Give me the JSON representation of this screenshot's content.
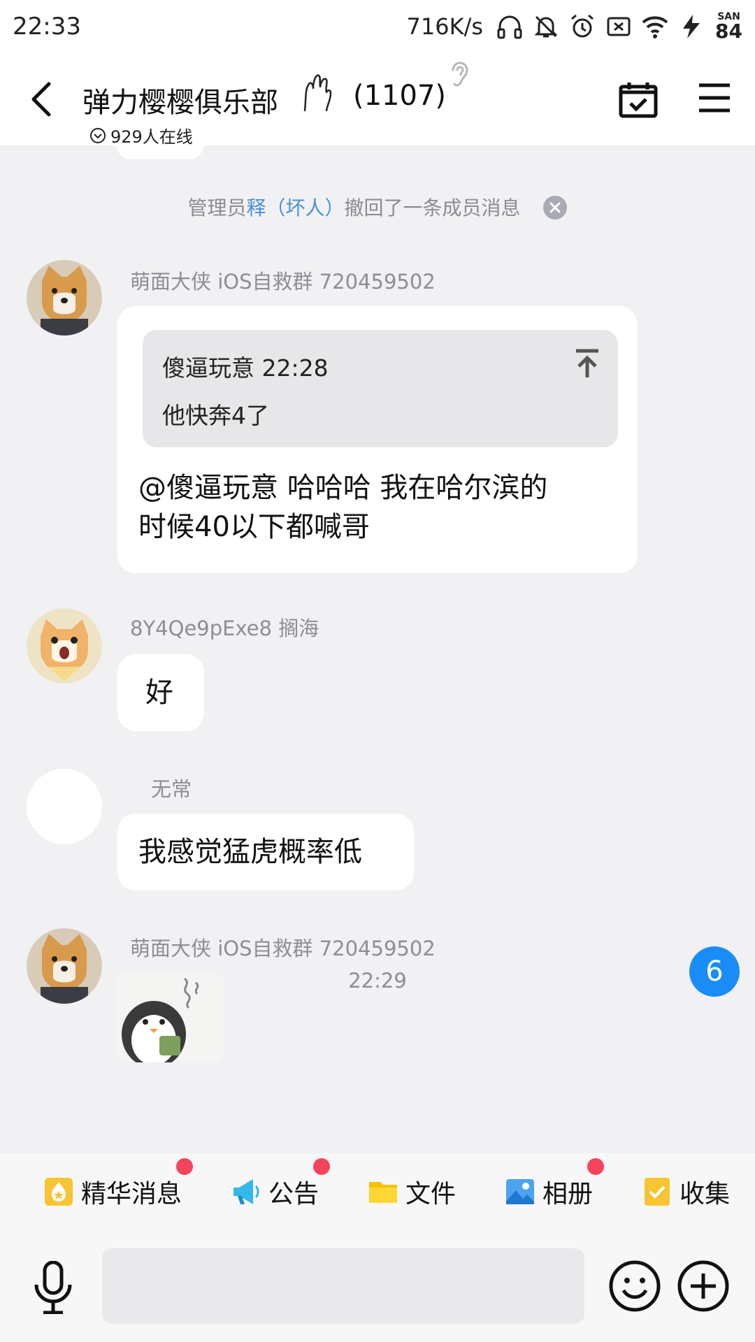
{
  "status_bar": {
    "time": "22:33",
    "net_speed": "716K/s",
    "battery_label": "SAN",
    "battery_level": "84",
    "icons": [
      "headphones-icon",
      "bell-off-icon",
      "alarm-icon",
      "no-sim-icon",
      "wifi-icon",
      "charging-icon"
    ]
  },
  "header": {
    "title": "弹力樱樱俱乐部",
    "member_count": "(1107)",
    "online": "929人在线"
  },
  "chat": {
    "system_notice": {
      "prefix": "管理员",
      "admin": "释（坏人）",
      "suffix": "撤回了一条成员消息"
    },
    "messages": [
      {
        "sender": "萌面大侠 iOS自救群 720459502",
        "quote_author": "傻逼玩意 22:28",
        "quote_text": "他快奔4了",
        "line1": "@傻逼玩意 哈哈哈 我在哈尔滨的",
        "line2": "时候40以下都喊哥"
      },
      {
        "sender": "8Y4Qe9pExe8 搁海",
        "text": "好"
      },
      {
        "sender": "无常",
        "text": "我感觉猛虎概率低"
      },
      {
        "sender": "萌面大侠 iOS自救群 720459502",
        "sticker": "penguin-sticker"
      }
    ],
    "time_divider": "22:29",
    "unread_count": "6"
  },
  "quick_bar": {
    "items": [
      {
        "label": "精华消息",
        "icon": "essence-icon",
        "dot": true
      },
      {
        "label": "公告",
        "icon": "megaphone-icon",
        "dot": true
      },
      {
        "label": "文件",
        "icon": "folder-icon",
        "dot": false
      },
      {
        "label": "相册",
        "icon": "album-icon",
        "dot": true
      },
      {
        "label": "收集",
        "icon": "collect-icon",
        "dot": false
      }
    ]
  },
  "input_bar": {
    "placeholder": "",
    "value": ""
  },
  "colors": {
    "accent": "#1a8cf5",
    "badge_red": "#f5445b",
    "admin_link": "#4a8fd8",
    "chat_bg": "#f1f1f3"
  }
}
